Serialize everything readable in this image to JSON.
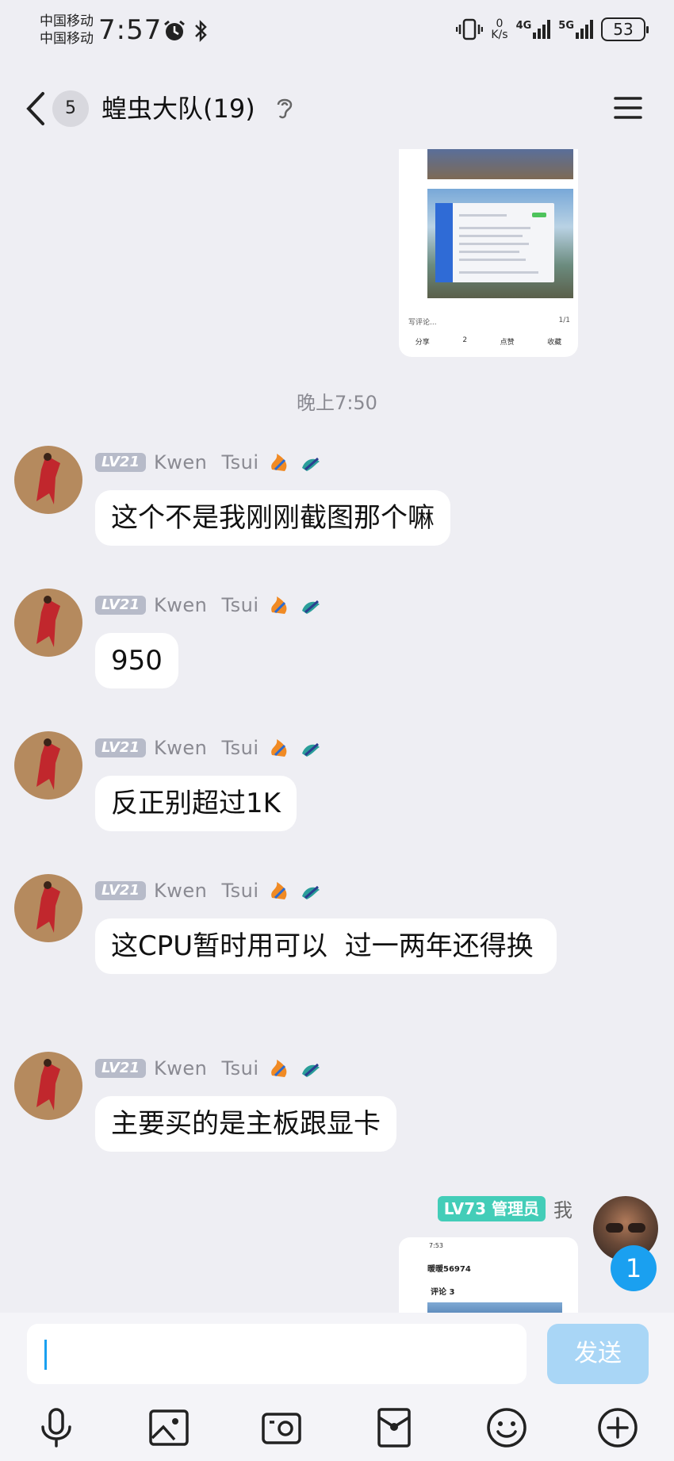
{
  "status_bar": {
    "carrier1": "中国移动",
    "carrier2": "中国移动",
    "time": "7:57",
    "net_speed_value": "0",
    "net_speed_unit": "K/s",
    "signal1_label": "4G",
    "signal2_label": "5G",
    "battery": "53"
  },
  "header": {
    "unread_count": "5",
    "title": "蝗虫大队(19)"
  },
  "share_card": {
    "comment_placeholder": "写评论...",
    "pager": "1/1",
    "actions": [
      "分享",
      "2",
      "点赞",
      "收藏"
    ]
  },
  "timestamp": "晚上7:50",
  "messages": [
    {
      "level": "LV21",
      "sender": "Kwen Tsui",
      "text": "这个不是我刚刚截图那个嘛"
    },
    {
      "level": "LV21",
      "sender": "Kwen Tsui",
      "text": "950"
    },
    {
      "level": "LV21",
      "sender": "Kwen Tsui",
      "text": "反正别超过1K"
    },
    {
      "level": "LV21",
      "sender": "Kwen Tsui",
      "text": "这CPU暂时用可以  过一两年还得换"
    },
    {
      "level": "LV21",
      "sender": "Kwen Tsui",
      "text": "主要买的是主板跟显卡"
    }
  ],
  "my_message": {
    "level": "LV73 管理员",
    "me_label": "我",
    "unread_badge": "1",
    "shot_time": "7:53",
    "shot_name": "暖暖56974",
    "shot_comments": "评论 3"
  },
  "input": {
    "placeholder": "",
    "send_label": "发送"
  },
  "toolbar": {
    "icons": [
      "microphone-icon",
      "image-icon",
      "camera-icon",
      "red-packet-icon",
      "emoji-icon",
      "plus-icon"
    ]
  }
}
